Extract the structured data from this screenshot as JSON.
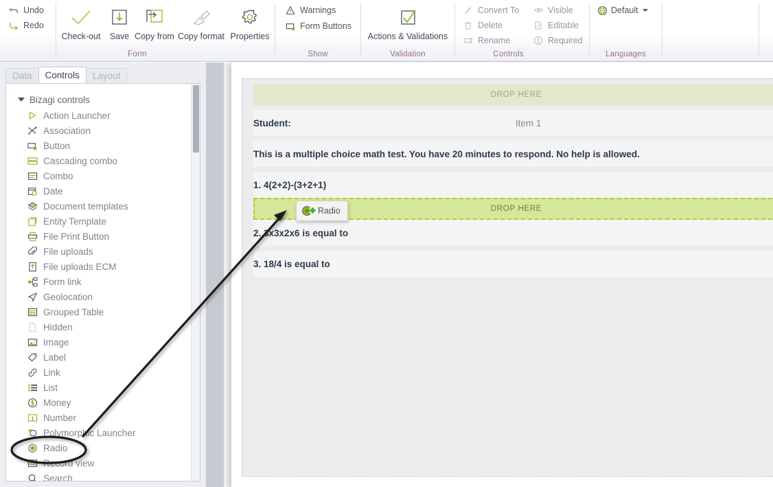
{
  "ribbon": {
    "groups": [
      {
        "name": "Form",
        "quick": [
          {
            "label": "Undo",
            "icon": "undo-arrow-icon"
          },
          {
            "label": "Redo",
            "icon": "redo-arrow-icon"
          }
        ],
        "buttons": [
          {
            "label": "Check-out",
            "icon": "checkmark-icon"
          },
          {
            "label": "Save",
            "icon": "save-download-icon"
          },
          {
            "label": "Copy from",
            "icon": "copy-from-icon"
          },
          {
            "label": "Copy format",
            "icon": "format-painter-icon"
          },
          {
            "label": "Properties",
            "icon": "gear-icon"
          }
        ]
      },
      {
        "name": "Show",
        "items": [
          {
            "label": "Warnings",
            "icon": "warning-triangle-icon"
          },
          {
            "label": "Form Buttons",
            "icon": "form-button-icon"
          }
        ]
      },
      {
        "name": "Validation",
        "buttons": [
          {
            "label": "Actions & Validations",
            "icon": "checkbox-check-icon"
          }
        ]
      },
      {
        "name": "Controls",
        "items": [
          {
            "label": "Convert To",
            "icon": "convert-wand-icon"
          },
          {
            "label": "Delete",
            "icon": "trash-icon"
          },
          {
            "label": "Rename",
            "icon": "rename-icon"
          }
        ],
        "items2": [
          {
            "label": "Visible",
            "icon": "eye-icon"
          },
          {
            "label": "Editable",
            "icon": "page-pencil-icon"
          },
          {
            "label": "Required",
            "icon": "exclamation-circle-icon"
          }
        ]
      },
      {
        "name": "Languages",
        "items": [
          {
            "label": "Default",
            "icon": "globe-icon",
            "dropdown": true
          }
        ]
      }
    ]
  },
  "left_panel": {
    "tabs": [
      {
        "label": "Data",
        "active": false
      },
      {
        "label": "Controls",
        "active": true
      },
      {
        "label": "Layout",
        "active": false
      }
    ],
    "group_title": "Bizagi controls",
    "controls": [
      {
        "label": "Action Launcher",
        "icon": "play-triangle-icon"
      },
      {
        "label": "Association",
        "icon": "association-icon"
      },
      {
        "label": "Button",
        "icon": "button-icon"
      },
      {
        "label": "Cascading combo",
        "icon": "cascading-combo-icon"
      },
      {
        "label": "Combo",
        "icon": "combo-icon"
      },
      {
        "label": "Date",
        "icon": "calendar-clock-icon"
      },
      {
        "label": "Document templates",
        "icon": "document-templates-icon"
      },
      {
        "label": "Entity Template",
        "icon": "entity-template-icon"
      },
      {
        "label": "File Print Button",
        "icon": "printer-icon"
      },
      {
        "label": "File uploads",
        "icon": "paperclip-icon"
      },
      {
        "label": "File uploads ECM",
        "icon": "upload-box-icon"
      },
      {
        "label": "Form link",
        "icon": "form-link-icon"
      },
      {
        "label": "Geolocation",
        "icon": "geolocation-arrow-icon"
      },
      {
        "label": "Grouped Table",
        "icon": "grouped-table-icon"
      },
      {
        "label": "Hidden",
        "icon": "hidden-page-icon"
      },
      {
        "label": "Image",
        "icon": "image-icon"
      },
      {
        "label": "Label",
        "icon": "label-tag-icon"
      },
      {
        "label": "Link",
        "icon": "link-chain-icon"
      },
      {
        "label": "List",
        "icon": "list-icon"
      },
      {
        "label": "Money",
        "icon": "money-dollar-icon"
      },
      {
        "label": "Number",
        "icon": "number-icon"
      },
      {
        "label": "Polymorphic Launcher",
        "icon": "polymorphic-launcher-icon"
      },
      {
        "label": "Radio",
        "icon": "radio-icon"
      },
      {
        "label": "Record view",
        "icon": "record-view-icon"
      },
      {
        "label": "Search",
        "icon": "search-icon"
      }
    ]
  },
  "canvas": {
    "rows": [
      {
        "type": "drop",
        "label": "DROP HERE",
        "state": "passive"
      },
      {
        "type": "field",
        "label": "Student:",
        "value": "Item 1"
      },
      {
        "type": "text",
        "label": "This is a multiple choice math test. You have 20 minutes to respond. No help is allowed."
      },
      {
        "type": "text",
        "label": "1. 4(2+2)-(3+2+1)"
      },
      {
        "type": "drop",
        "label": "DROP HERE",
        "state": "active"
      },
      {
        "type": "text",
        "label": "2. 3x3x2x6 is equal to"
      },
      {
        "type": "text",
        "label": "3. 18/4 is equal to"
      }
    ]
  },
  "drag_ghost": {
    "label": "Radio",
    "icon": "radio-add-icon"
  },
  "colors": {
    "accent_green": "#8cb820",
    "drop_active_bg": "#d5e79a",
    "drop_passive_bg": "#e3e8cd",
    "group_name": "#9b6b8a",
    "annotation": "#1b1b1b"
  }
}
